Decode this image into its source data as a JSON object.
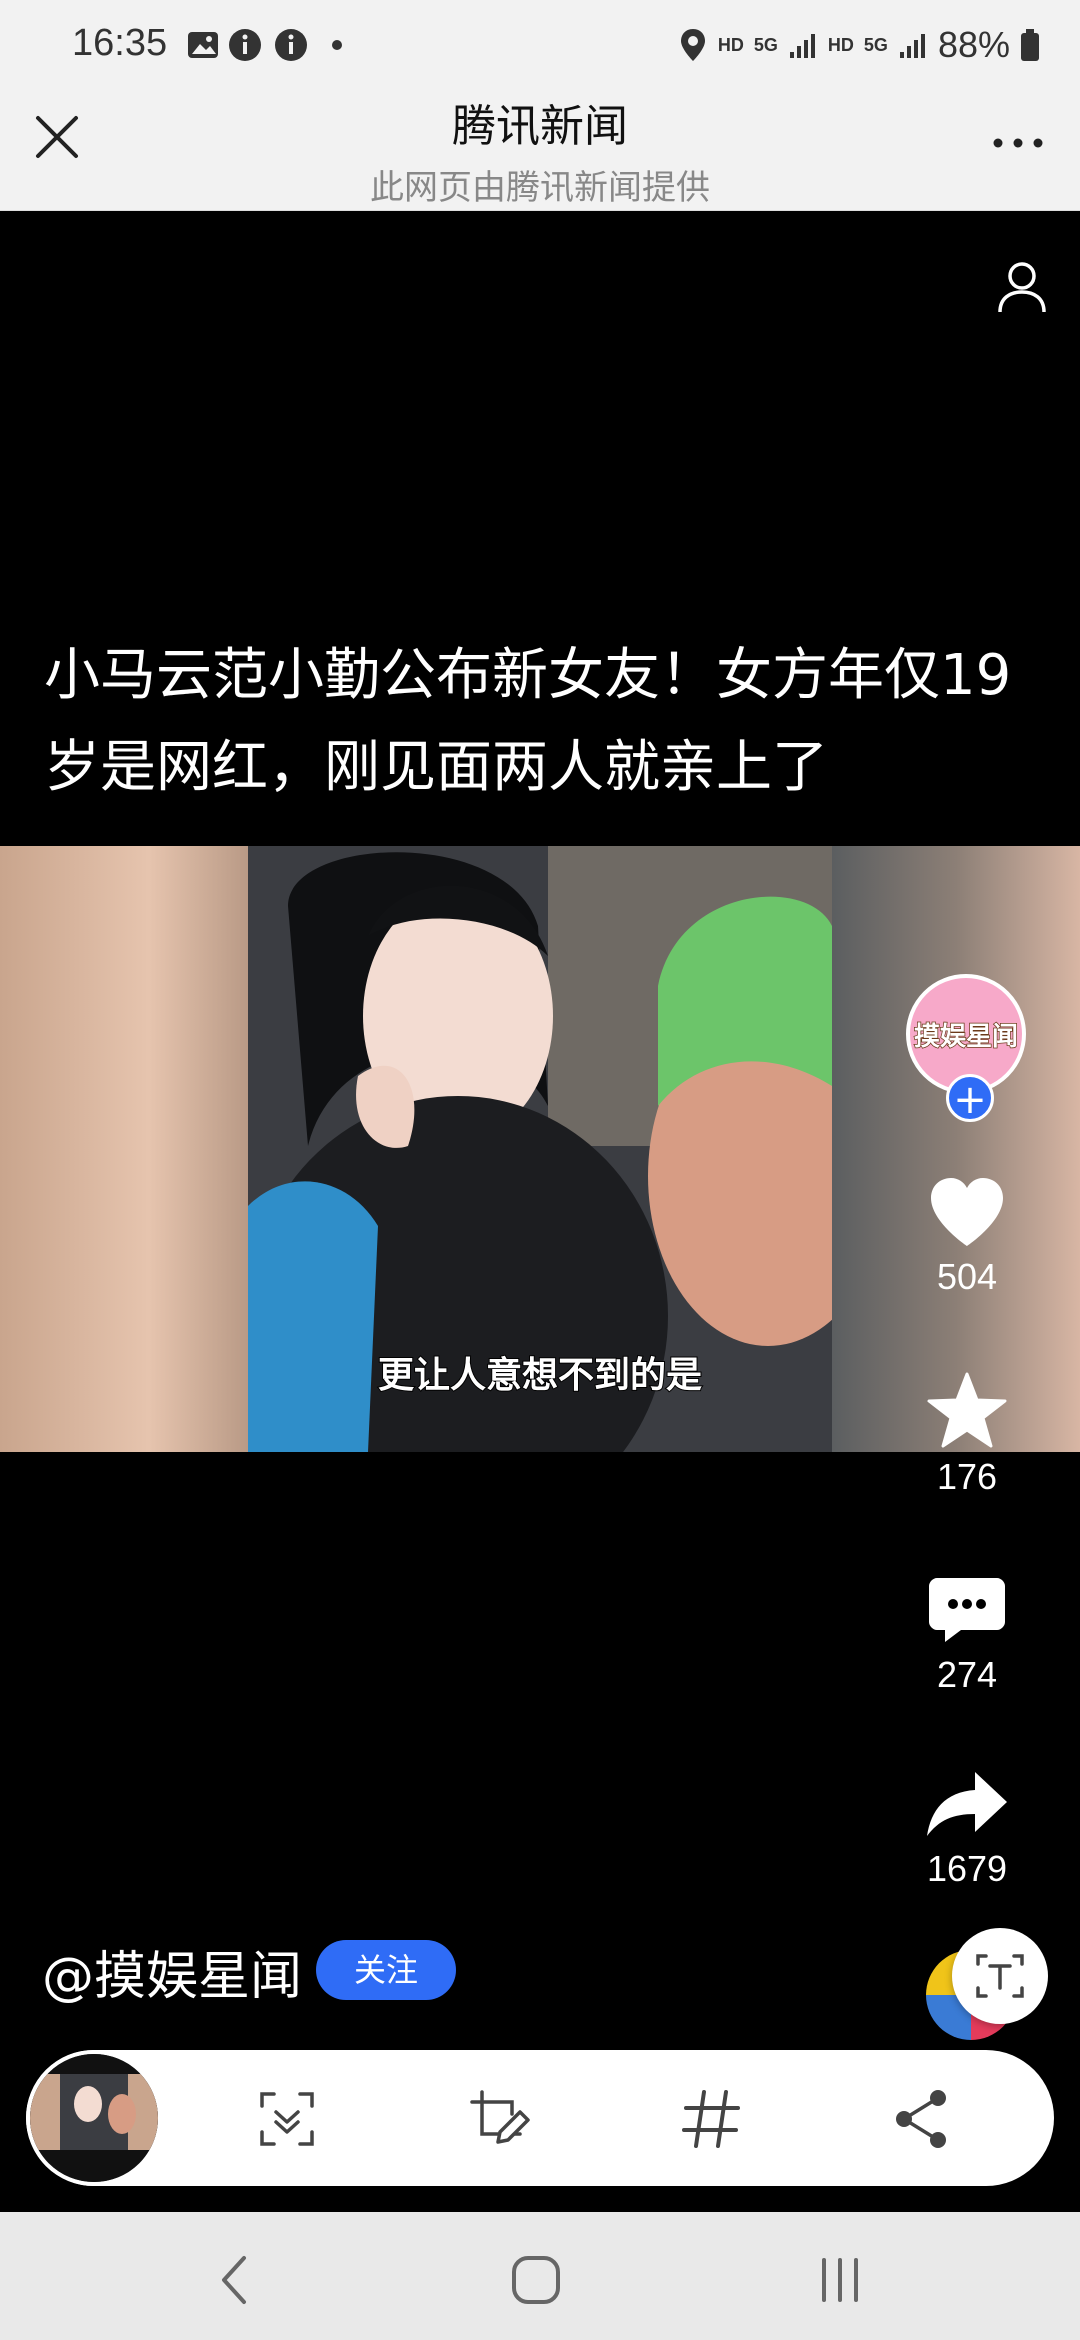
{
  "status_bar": {
    "time": "16:35",
    "network_labels": [
      "HD",
      "5G",
      "HD",
      "5G"
    ],
    "battery": "88%"
  },
  "header": {
    "title": "腾讯新闻",
    "subtitle": "此网页由腾讯新闻提供"
  },
  "article": {
    "headline": "小马云范小勤公布新女友！女方年仅19岁是网红，刚见面两人就亲上了",
    "video_caption": "更让人意想不到的是"
  },
  "channel": {
    "avatar_text": "摸娱星闻",
    "author": "@摸娱星闻",
    "follow_label": "关注"
  },
  "actions": {
    "likes": "504",
    "favorites": "176",
    "comments": "274",
    "shares": "1679"
  },
  "colors": {
    "accent": "#2f6cf6",
    "background": "#000000",
    "bar": "#f2f2f2"
  }
}
